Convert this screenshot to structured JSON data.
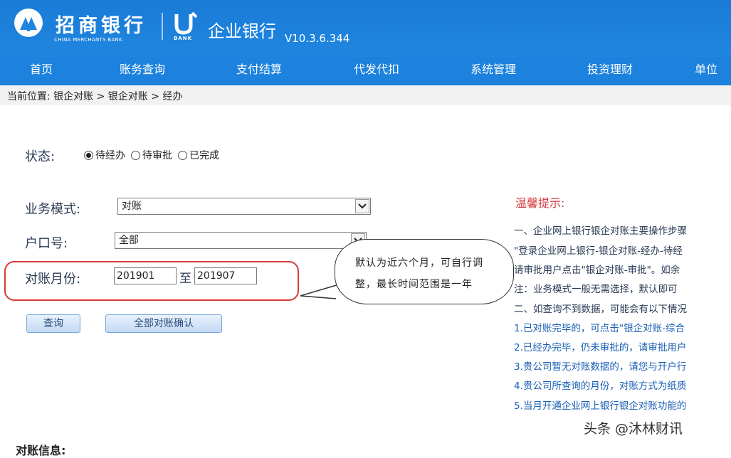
{
  "header": {
    "bank_name": "招商银行",
    "bank_name_en": "CHINA MERCHANTS BANK",
    "brand_sub": "BANK",
    "app_name": "企业银行",
    "version": "V10.3.6.344"
  },
  "nav": {
    "items": [
      "首页",
      "账务查询",
      "支付结算",
      "代发代扣",
      "系统管理",
      "投资理财",
      "单位"
    ]
  },
  "breadcrumb": "当前位置: 银企对账 > 银企对账 > 经办",
  "form": {
    "status_label": "状态:",
    "status_options": [
      {
        "label": "待经办",
        "checked": true
      },
      {
        "label": "待审批",
        "checked": false
      },
      {
        "label": "已完成",
        "checked": false
      }
    ],
    "business_mode_label": "业务模式:",
    "business_mode_value": "对账",
    "account_label": "户口号:",
    "account_value": "全部",
    "month_label": "对账月份:",
    "month_from": "201901",
    "month_to_sep": "至",
    "month_to": "201907"
  },
  "buttons": {
    "query": "查询",
    "confirm_all": "全部对账确认"
  },
  "callout": {
    "text": "默认为近六个月，可自行调整，最长时间范围是一年"
  },
  "tips": {
    "title": "温馨提示:",
    "lines": [
      {
        "text": "一、企业网上银行银企对账主要操作步骤",
        "color": "#2a3a55"
      },
      {
        "text": "\"登录企业网上银行-银企对账-经办-待经",
        "color": "#2a3a55"
      },
      {
        "text": "请审批用户点击\"银企对账-审批\"。如余",
        "color": "#2a3a55"
      },
      {
        "text": "注：业务模式一般无需选择，默认即可",
        "color": "#2a3a55"
      },
      {
        "text": "二、如查询不到数据，可能会有以下情况",
        "color": "#2a3a55"
      },
      {
        "text": "1.已对账完毕的，可点击\"银企对账-综合",
        "color": "#1a5fb4"
      },
      {
        "text": "2.已经办完毕，仍未审批的，请审批用户",
        "color": "#1a5fb4"
      },
      {
        "text": "3.贵公司暂无对账数据的，请您与开户行",
        "color": "#1a5fb4"
      },
      {
        "text": "4.贵公司所查询的月份，对账方式为纸质",
        "color": "#1a5fb4"
      },
      {
        "text": "5.当月开通企业网上银行银企对账功能的",
        "color": "#1a5fb4"
      }
    ]
  },
  "footer_label": "对账信息:",
  "watermark": "头条 @沐林财讯",
  "colors": {
    "header_blue": "#1f86e0",
    "nav_blue": "#1c82dd",
    "tip_red": "#d2373d",
    "highlight_red": "#d83a3a"
  }
}
